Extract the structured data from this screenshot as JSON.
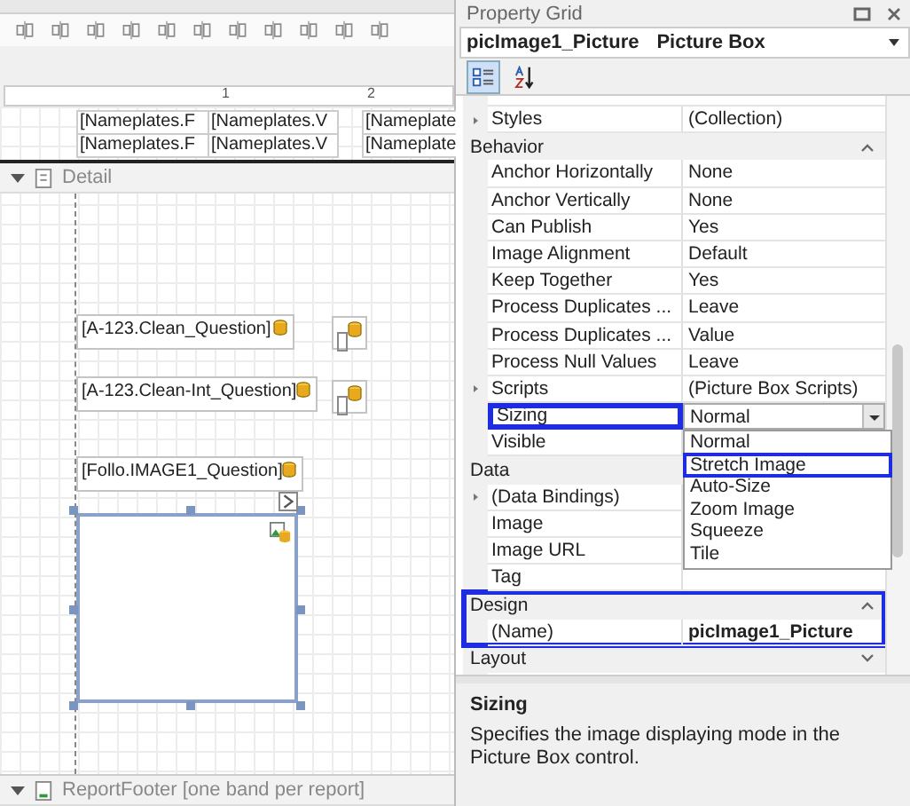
{
  "designer": {
    "ruler_labels": [
      "1",
      "2"
    ],
    "header_rows": [
      [
        "[Nameplates.F",
        "[Nameplates.V",
        "[Nameplate"
      ],
      [
        "[Nameplates.F",
        "[Nameplates.V",
        "[Nameplate"
      ]
    ],
    "detail_band": {
      "label": "Detail",
      "expanded": true
    },
    "controls": [
      {
        "kind": "field",
        "text": "[A-123.Clean_Question]"
      },
      {
        "kind": "checkbox"
      },
      {
        "kind": "field",
        "text": "[A-123.Clean-Int_Question]"
      },
      {
        "kind": "checkbox"
      },
      {
        "kind": "field",
        "text": "[Follo.IMAGE1_Question]"
      },
      {
        "kind": "picture_box",
        "selected": true
      }
    ],
    "footer_band": {
      "label": "ReportFooter [one band per report]",
      "expanded": true
    }
  },
  "property_grid": {
    "title": "Property Grid",
    "object_name": "picImage1_Picture",
    "object_type": "Picture Box",
    "rows": [
      {
        "kind": "property",
        "label": "Styles",
        "value": "(Collection)",
        "expandable": true,
        "highlighted": false
      },
      {
        "kind": "category",
        "label": "Behavior",
        "expanded": true,
        "highlighted": false
      },
      {
        "kind": "property",
        "label": "Anchor Horizontally",
        "value": "None",
        "expandable": false,
        "highlighted": false
      },
      {
        "kind": "property",
        "label": "Anchor Vertically",
        "value": "None",
        "expandable": false,
        "highlighted": false
      },
      {
        "kind": "property",
        "label": "Can Publish",
        "value": "Yes",
        "expandable": false,
        "highlighted": false
      },
      {
        "kind": "property",
        "label": "Image Alignment",
        "value": "Default",
        "expandable": false,
        "highlighted": false
      },
      {
        "kind": "property",
        "label": "Keep Together",
        "value": "Yes",
        "expandable": false,
        "highlighted": false
      },
      {
        "kind": "property",
        "label": "Process Duplicates ...",
        "value": "Leave",
        "expandable": false,
        "highlighted": false
      },
      {
        "kind": "property",
        "label": "Process Duplicates ...",
        "value": "Value",
        "expandable": false,
        "highlighted": false
      },
      {
        "kind": "property",
        "label": "Process Null Values",
        "value": "Leave",
        "expandable": false,
        "highlighted": false
      },
      {
        "kind": "property",
        "label": "Scripts",
        "value": "(Picture Box Scripts)",
        "expandable": true,
        "highlighted": false
      },
      {
        "kind": "dropdown",
        "label": "Sizing",
        "value": "Normal",
        "expandable": false,
        "highlighted": true,
        "open": true,
        "options": [
          {
            "label": "Normal",
            "highlighted": false
          },
          {
            "label": "Stretch Image",
            "highlighted": true
          },
          {
            "label": "Auto-Size",
            "highlighted": false
          },
          {
            "label": "Zoom Image",
            "highlighted": false
          },
          {
            "label": "Squeeze",
            "highlighted": false
          },
          {
            "label": "Tile",
            "highlighted": false
          }
        ]
      },
      {
        "kind": "property",
        "label": "Visible",
        "expandable": false,
        "highlighted": false
      },
      {
        "kind": "category",
        "label": "Data",
        "highlighted": false
      },
      {
        "kind": "property",
        "label": "(Data Bindings)",
        "expandable": true,
        "highlighted": false
      },
      {
        "kind": "property",
        "label": "Image",
        "expandable": false,
        "highlighted": false
      },
      {
        "kind": "property",
        "label": "Image URL",
        "expandable": false,
        "highlighted": false
      },
      {
        "kind": "property",
        "label": "Tag",
        "expandable": false,
        "highlighted": false
      },
      {
        "kind": "category",
        "label": "Design",
        "expanded": true,
        "highlighted": true,
        "rows": [
          {
            "kind": "property",
            "label": "(Name)",
            "value": "picImage1_Picture",
            "bold": true,
            "expandable": false,
            "highlighted": false
          }
        ]
      },
      {
        "kind": "category",
        "label": "Layout",
        "expanded": false,
        "highlighted": false
      }
    ],
    "description": {
      "title": "Sizing",
      "text": "Specifies the image displaying mode in the Picture Box control."
    }
  }
}
